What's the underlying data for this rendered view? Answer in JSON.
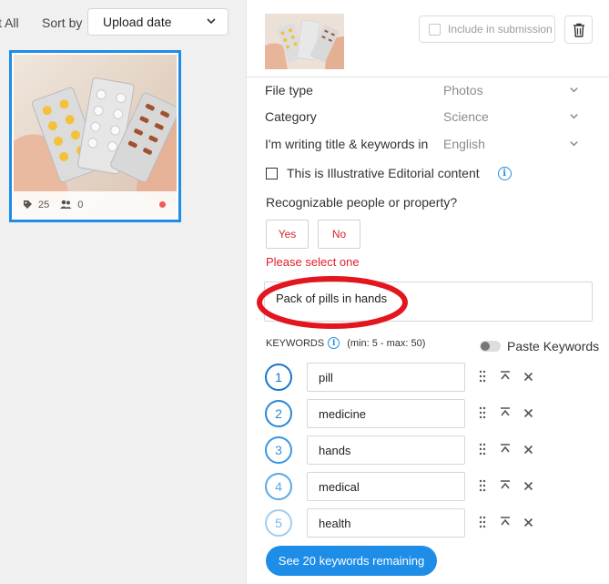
{
  "toolbar": {
    "select_all_label": "t All",
    "sort_label": "Sort by",
    "sort_value": "Upload date"
  },
  "thumbnail": {
    "keyword_count": "25",
    "people_count": "0",
    "status_color": "#f05a5a"
  },
  "header": {
    "include_label": "Include in submission"
  },
  "fields": [
    {
      "label": "File type",
      "value": "Photos"
    },
    {
      "label": "Category",
      "value": "Science"
    },
    {
      "label": "I'm writing title & keywords in",
      "value": "English"
    }
  ],
  "editorial_label": "This is Illustrative Editorial content",
  "recognizable": {
    "question": "Recognizable people or property?",
    "yes_label": "Yes",
    "no_label": "No",
    "error": "Please select one"
  },
  "title_value": "Pack of pills in hands",
  "keywords": {
    "header": "KEYWORDS",
    "limits": "(min: 5 - max: 50)",
    "paste_label": "Paste Keywords",
    "items": [
      {
        "num": "1",
        "text": "pill"
      },
      {
        "num": "2",
        "text": "medicine"
      },
      {
        "num": "3",
        "text": "hands"
      },
      {
        "num": "4",
        "text": "medical"
      },
      {
        "num": "5",
        "text": "health"
      }
    ],
    "see_more_label": "See 20 keywords remaining"
  },
  "colors": {
    "accent": "#1e8de8",
    "error": "#e0202a",
    "annotation": "#e3151e"
  },
  "icons": [
    "chevron-down-icon",
    "tag-icon",
    "people-icon",
    "trash-icon",
    "info-icon",
    "drag-handle-icon",
    "move-to-top-icon",
    "close-icon"
  ]
}
